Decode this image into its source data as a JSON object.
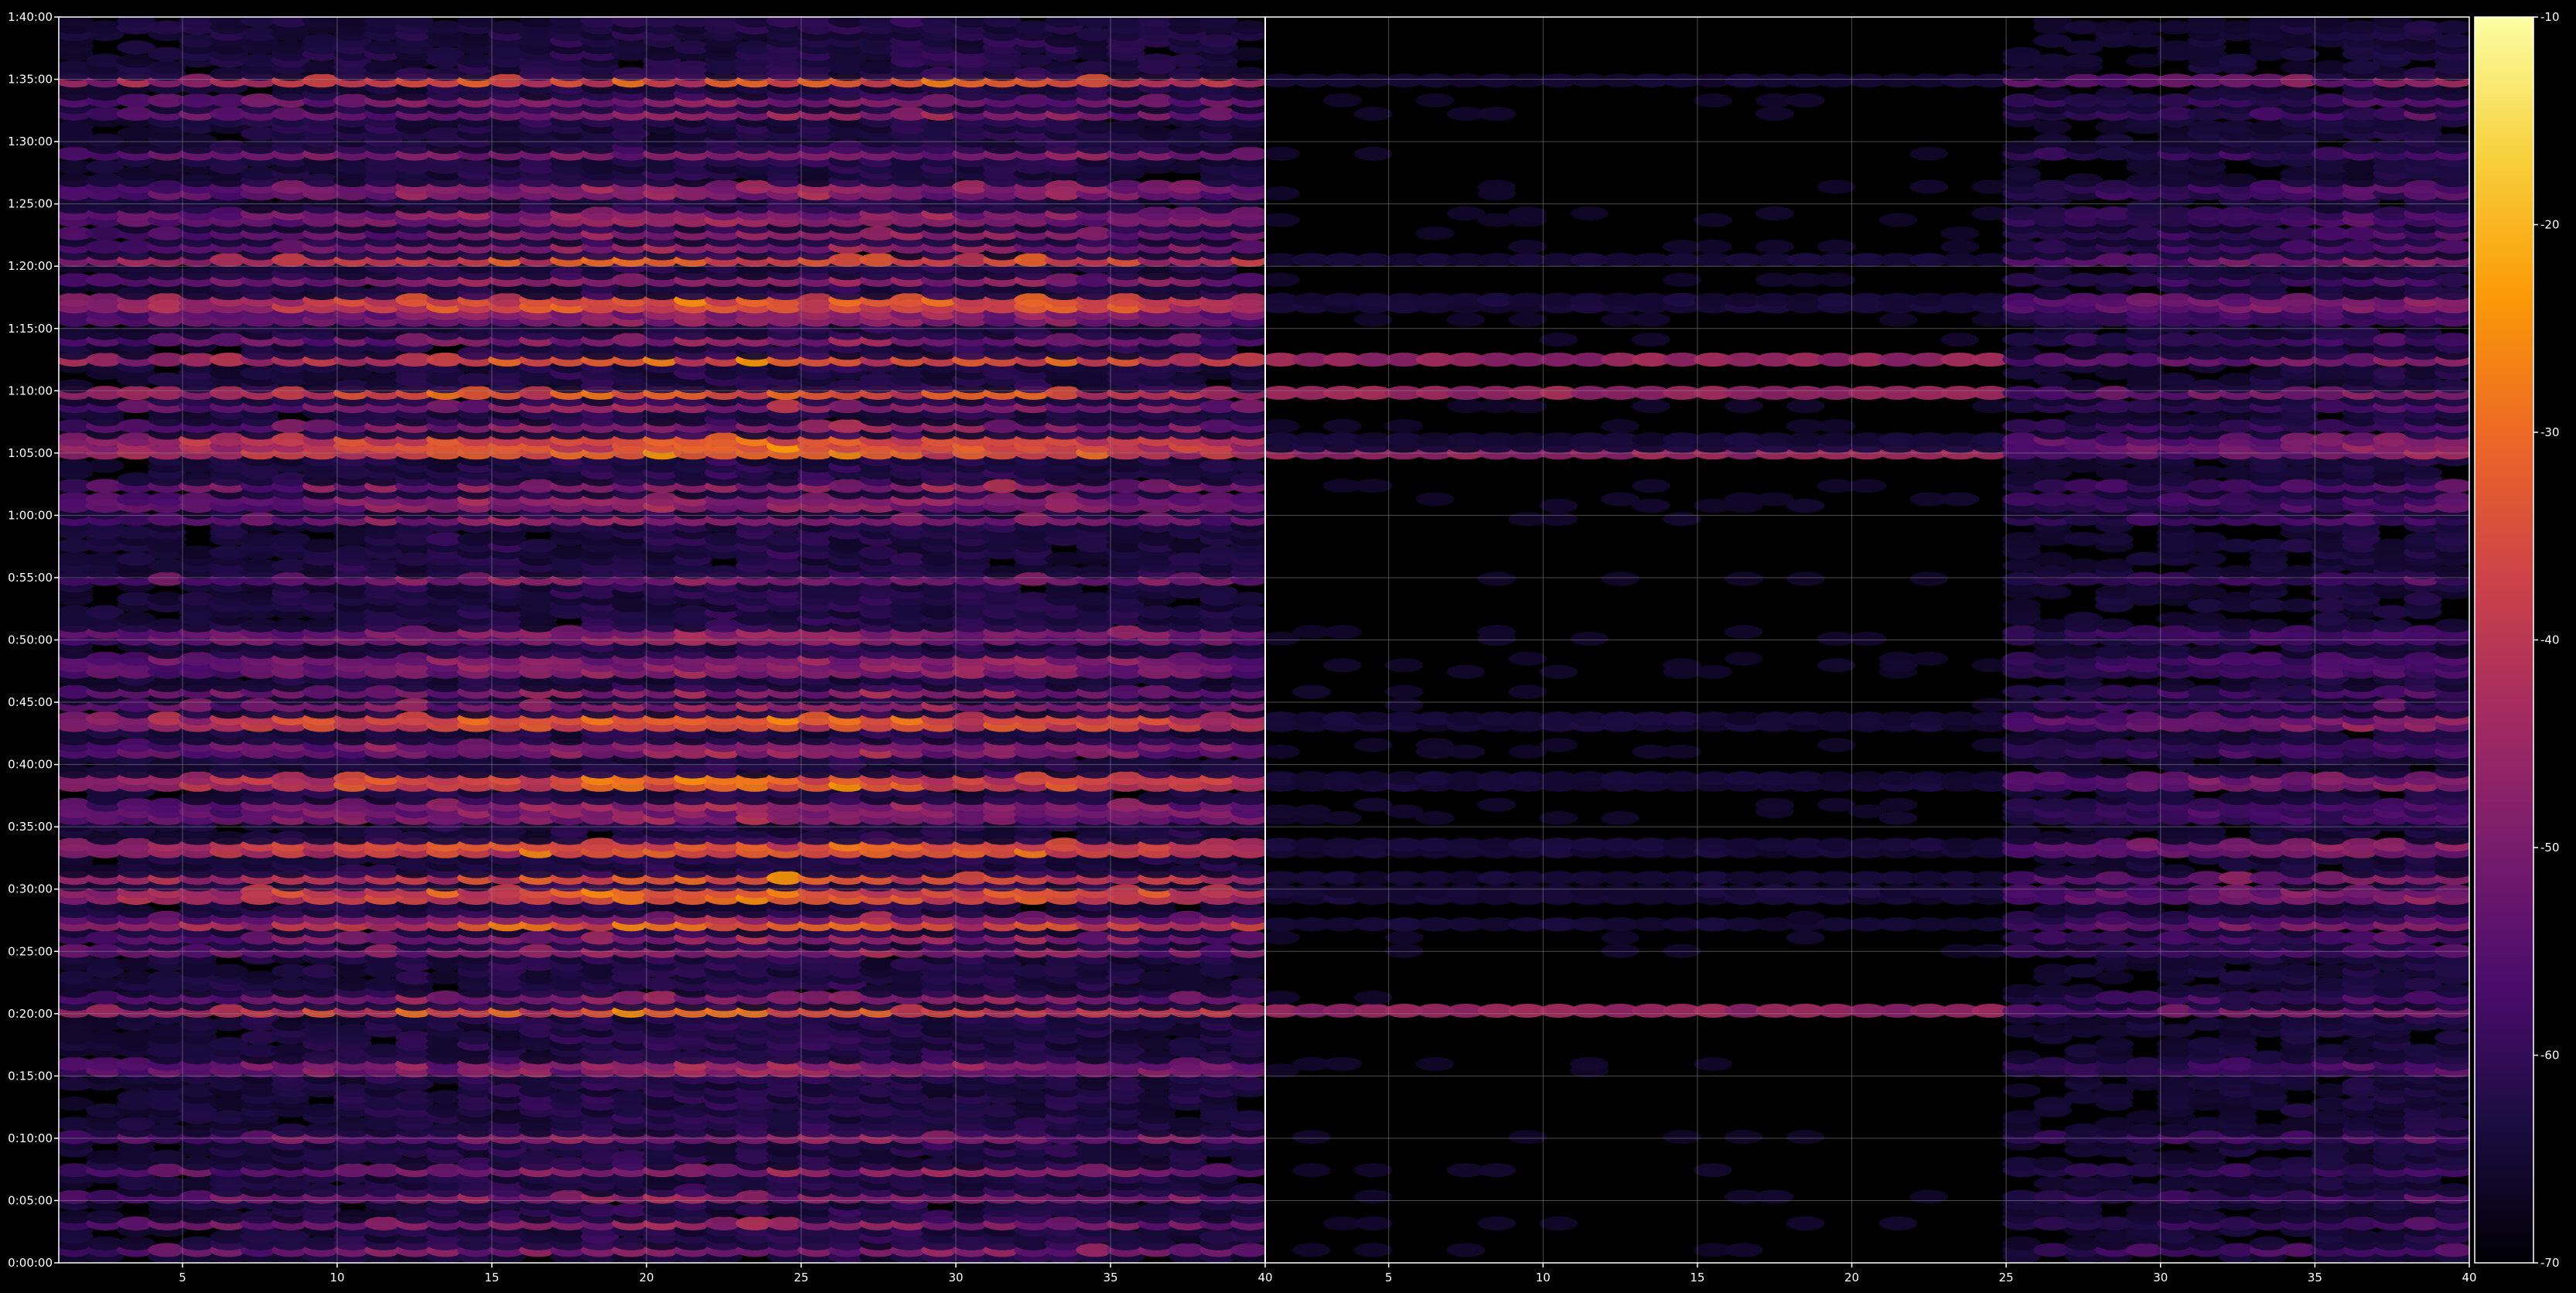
{
  "chart_data": {
    "type": "heatmap",
    "title": "",
    "xlabel": "",
    "ylabel": "",
    "grid": true,
    "colormap": "inferno",
    "background": "#000000",
    "panels": [
      {
        "name": "",
        "xlim": [
          1,
          40
        ],
        "x_ticks": [
          5,
          10,
          15,
          20,
          25,
          30,
          35,
          40
        ],
        "x_tick_labels": [
          "5",
          "10",
          "15",
          "20",
          "25",
          "30",
          "35",
          "40"
        ],
        "columns": 39,
        "column_activity": "high across all columns, strongest near columns 20-37"
      },
      {
        "name": "",
        "xlim": [
          1,
          40
        ],
        "x_ticks": [
          5,
          10,
          15,
          20,
          25,
          30,
          35,
          40
        ],
        "x_tick_labels": [
          "5",
          "10",
          "15",
          "20",
          "25",
          "30",
          "35",
          "40"
        ],
        "columns": 39,
        "column_activity": "sparse in columns 1-24, dense in columns 25-39"
      }
    ],
    "y_unit_seconds": true,
    "ylim": [
      0,
      6000
    ],
    "y_ticks": [
      0,
      300,
      600,
      900,
      1200,
      1500,
      1800,
      2100,
      2400,
      2700,
      3000,
      3300,
      3600,
      3900,
      4200,
      4500,
      4800,
      5100,
      5400,
      5700,
      6000
    ],
    "y_tick_labels": [
      "0:00:00",
      "0:05:00",
      "0:10:00",
      "0:15:00",
      "0:20:00",
      "0:25:00",
      "0:30:00",
      "0:35:00",
      "0:40:00",
      "0:45:00",
      "0:50:00",
      "0:55:00",
      "1:00:00",
      "1:05:00",
      "1:10:00",
      "1:15:00",
      "1:20:00",
      "1:25:00",
      "1:30:00",
      "1:35:00",
      "1:40:00"
    ],
    "strong_rows_seconds": [
      1212,
      1638,
      1770,
      1845,
      1995,
      2292,
      2340,
      2610,
      3900,
      3945,
      4200,
      4350,
      4620,
      4835,
      5685
    ],
    "medium_rows_seconds": [
      60,
      195,
      330,
      445,
      615,
      940,
      1272,
      1498,
      1578,
      1665,
      2158,
      2199,
      2453,
      2493,
      2694,
      2754,
      2865,
      2910,
      3024,
      3282,
      3570,
      3660,
      3735,
      4032,
      4116,
      4445,
      4560,
      4740,
      4895,
      4966,
      5040,
      5166,
      5334,
      5545,
      5604
    ],
    "colorbar": {
      "min": -70,
      "max": -10,
      "ticks": [
        -10,
        -20,
        -30,
        -40,
        -50,
        -60,
        -70
      ],
      "tick_labels": [
        "-10",
        "-20",
        "-30",
        "-40",
        "-50",
        "-60",
        "-70"
      ],
      "label": ""
    },
    "colors": {
      "inferno_stops": [
        "#000004",
        "#1b0c41",
        "#4a0c6b",
        "#781c6d",
        "#a52c60",
        "#cf4446",
        "#ed6925",
        "#fb9b06",
        "#f7d13d",
        "#fcffa4"
      ],
      "axes": "#ffffff",
      "grid": "#8a8a8a"
    }
  }
}
